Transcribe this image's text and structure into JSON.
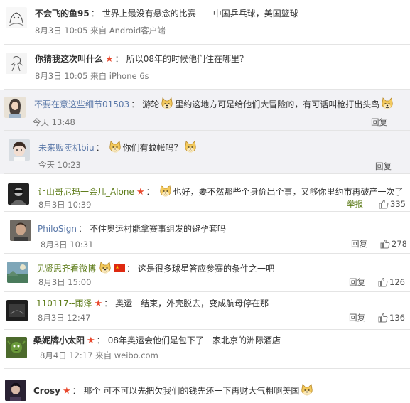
{
  "comments": [
    {
      "name": "不会飞的鱼95",
      "text": "世界上最没有悬念的比赛——中国乒乓球，美国篮球",
      "time": "8月3日 10:05",
      "source": "来自 Android客户端"
    },
    {
      "name": "你猜我这次叫什么",
      "text": "所以08年的时候他们住在哪里？",
      "time": "8月3日 10:05",
      "source": "来自 iPhone 6s"
    },
    {
      "name": "不要在意这些细节01503",
      "text_a": "游轮",
      "text_b": "里约这地方可是给他们大冒险的，有可话叫枪打出头鸟",
      "time": "今天 13:48",
      "reply": "回复"
    },
    {
      "name": "未来贩卖机biu",
      "text": "你们有蚊帐吗？",
      "time": "今天 10:23",
      "reply": "回复"
    },
    {
      "name": "让山哥尼玛一会儿_Alone",
      "text": "也好，要不然那些个身价出个事，又够你里约市再破产一次了",
      "time": "8月3日 10:39",
      "report": "举报",
      "likes": "335"
    },
    {
      "name": "PhiloSign",
      "text": "不住奥运村能拿赛事组发的避孕套吗",
      "time": "8月3日 10:31",
      "reply": "回复",
      "likes": "278"
    },
    {
      "name": "见贤思齐看微博",
      "text": "这是很多球星答应参赛的条件之一吧",
      "time": "8月3日 15:00",
      "reply": "回复",
      "likes": "126"
    },
    {
      "name": "110117--雨泽",
      "text": "奥运一结束，外壳脱去，变成航母停在那",
      "time": "8月3日 12:47",
      "reply": "回复",
      "likes": "136"
    },
    {
      "name": "桑妮牌小太阳",
      "text": "08年奥运会他们是包下了一家北京的洲际酒店",
      "time": "8月4日 12:17",
      "source": "来自 weibo.com"
    },
    {
      "name": "Crosy",
      "text": "那个 可不可以先把欠我们的钱先还一下再财大气粗啊美国"
    }
  ],
  "icons": {
    "star": "star-icon",
    "emoji": "doge-emoji-icon",
    "thumb": "thumbs-up-icon",
    "flag": "china-flag-icon"
  },
  "colors": {
    "star": "#e8482d",
    "link_blue": "#5a78a8",
    "link_green": "#5e7c1a",
    "sub_bg": "#f2f2f5"
  }
}
